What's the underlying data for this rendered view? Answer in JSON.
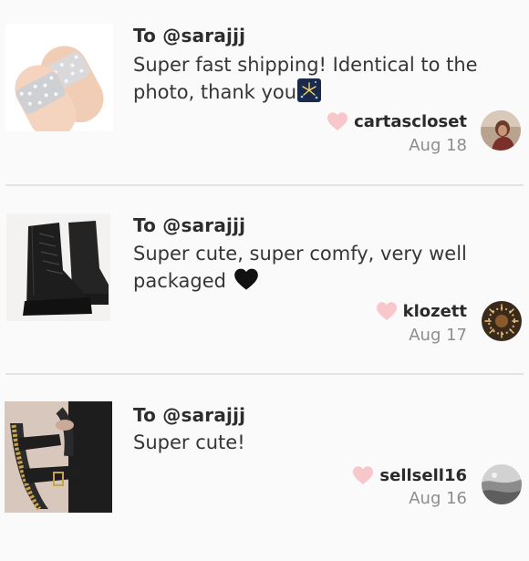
{
  "reviews": [
    {
      "to": "To @sarajjj",
      "message": "Super fast shipping! Identical to the photo, thank you",
      "message_emoji": "fireworks-emoji",
      "product_image": "clear-rhinestone-slide-sandals",
      "reviewer": "cartascloset",
      "date": "Aug 18",
      "liked": true
    },
    {
      "to": "To @sarajjj",
      "message": "Super cute, super comfy, very well packaged",
      "message_emoji": "black-heart-emoji",
      "product_image": "black-platform-lace-up-boots",
      "reviewer": "klozett",
      "date": "Aug 17",
      "liked": true
    },
    {
      "to": "To @sarajjj",
      "message": "Super cute!",
      "product_image": "black-gold-chain-sandals",
      "reviewer": "sellsell16",
      "date": "Aug 16",
      "liked": true
    }
  ],
  "colors": {
    "heart": "#f7c7cc",
    "divider": "#e3e3e3",
    "date": "#8d8d8d"
  }
}
